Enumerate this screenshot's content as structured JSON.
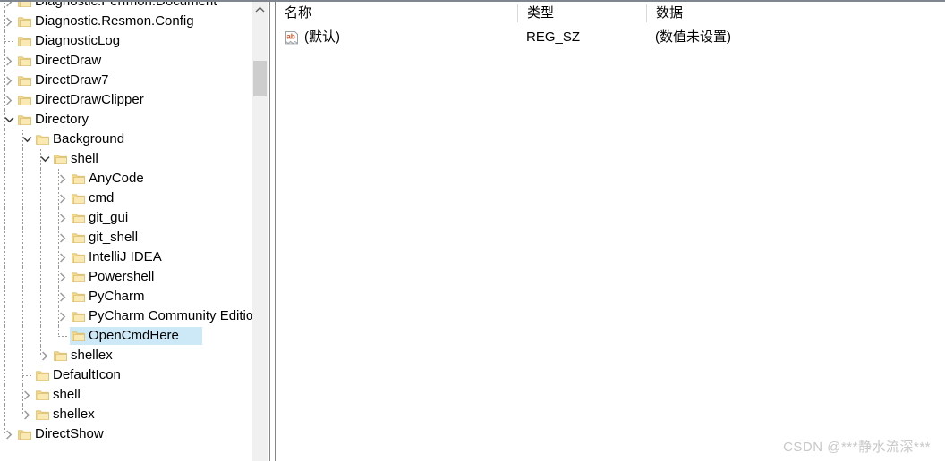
{
  "tree": {
    "selected_key": "OpenCmdHere",
    "selection_color": "#cde8f6",
    "folder_color": "#f5d98a",
    "items": [
      {
        "label": "Diagnostic.Perfmon.Document",
        "depth": 1,
        "state": "collapsed"
      },
      {
        "label": "Diagnostic.Resmon.Config",
        "depth": 1,
        "state": "collapsed"
      },
      {
        "label": "DiagnosticLog",
        "depth": 1,
        "state": "leaf"
      },
      {
        "label": "DirectDraw",
        "depth": 1,
        "state": "collapsed"
      },
      {
        "label": "DirectDraw7",
        "depth": 1,
        "state": "collapsed"
      },
      {
        "label": "DirectDrawClipper",
        "depth": 1,
        "state": "collapsed"
      },
      {
        "label": "Directory",
        "depth": 1,
        "state": "expanded"
      },
      {
        "label": "Background",
        "depth": 2,
        "state": "expanded"
      },
      {
        "label": "shell",
        "depth": 3,
        "state": "expanded"
      },
      {
        "label": "AnyCode",
        "depth": 4,
        "state": "collapsed"
      },
      {
        "label": "cmd",
        "depth": 4,
        "state": "collapsed"
      },
      {
        "label": "git_gui",
        "depth": 4,
        "state": "collapsed"
      },
      {
        "label": "git_shell",
        "depth": 4,
        "state": "collapsed"
      },
      {
        "label": "IntelliJ IDEA",
        "depth": 4,
        "state": "collapsed"
      },
      {
        "label": "Powershell",
        "depth": 4,
        "state": "collapsed"
      },
      {
        "label": "PyCharm",
        "depth": 4,
        "state": "collapsed"
      },
      {
        "label": "PyCharm Community Edition",
        "depth": 4,
        "state": "collapsed"
      },
      {
        "label": "OpenCmdHere",
        "depth": 4,
        "state": "leaf",
        "selected": true
      },
      {
        "label": "shellex",
        "depth": 3,
        "state": "collapsed"
      },
      {
        "label": "DefaultIcon",
        "depth": 2,
        "state": "leaf"
      },
      {
        "label": "shell",
        "depth": 2,
        "state": "collapsed"
      },
      {
        "label": "shellex",
        "depth": 2,
        "state": "collapsed"
      },
      {
        "label": "DirectShow",
        "depth": 1,
        "state": "collapsed"
      }
    ]
  },
  "scrollbar": {
    "up_arrow_icon": "chevron-up-icon",
    "thumb_color": "#cdcdcd",
    "track_color": "#f0f0f0"
  },
  "list": {
    "columns": [
      {
        "key": "name",
        "label": "名称"
      },
      {
        "key": "type",
        "label": "类型"
      },
      {
        "key": "data",
        "label": "数据"
      }
    ],
    "rows": [
      {
        "icon": "string-value-icon",
        "name": "(默认)",
        "type": "REG_SZ",
        "data": "(数值未设置)"
      }
    ]
  },
  "watermark": {
    "text": "CSDN @***静水流深***"
  }
}
